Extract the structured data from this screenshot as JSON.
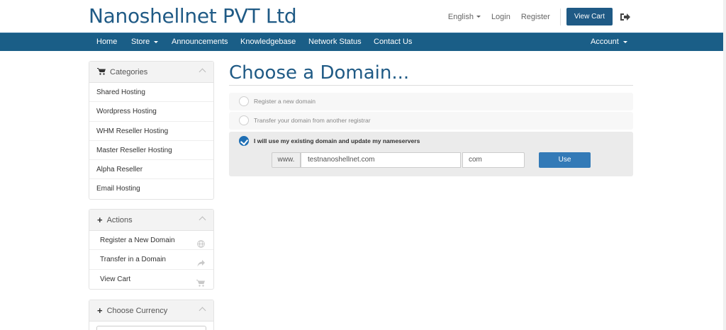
{
  "header": {
    "brand": "Nanoshellnet PVT Ltd",
    "language": "English",
    "login": "Login",
    "register": "Register",
    "view_cart": "View Cart",
    "logout_icon": "sign-out-icon"
  },
  "nav": {
    "items": [
      {
        "label": "Home"
      },
      {
        "label": "Store",
        "dropdown": true
      },
      {
        "label": "Announcements"
      },
      {
        "label": "Knowledgebase"
      },
      {
        "label": "Network Status"
      },
      {
        "label": "Contact Us"
      }
    ],
    "account": "Account"
  },
  "sidebar": {
    "categories": {
      "title": "Categories",
      "icon": "shopping-cart-icon",
      "items": [
        "Shared Hosting",
        "Wordpress Hosting",
        "WHM Reseller Hosting",
        "Master Reseller Hosting",
        "Alpha Reseller",
        "Email Hosting"
      ]
    },
    "actions": {
      "title": "Actions",
      "icon": "plus-icon",
      "items": [
        {
          "label": "Register a New Domain",
          "icon": "globe-icon"
        },
        {
          "label": "Transfer in a Domain",
          "icon": "share-icon"
        },
        {
          "label": "View Cart",
          "icon": "cart-icon"
        }
      ]
    },
    "currency": {
      "title": "Choose Currency",
      "icon": "plus-icon"
    }
  },
  "main": {
    "title": "Choose a Domain...",
    "options": [
      {
        "label": "Register a new domain",
        "selected": false
      },
      {
        "label": "Transfer your domain from another registrar",
        "selected": false
      },
      {
        "label": "I will use my existing domain and update my nameservers",
        "selected": true
      }
    ],
    "www_prefix": "www.",
    "domain_value": "testnanoshellnet.com",
    "tld_value": "com",
    "use_button": "Use"
  },
  "colors": {
    "brand": "#1f5a85",
    "navbar": "#1a5e87",
    "primary_button": "#337ab7"
  }
}
